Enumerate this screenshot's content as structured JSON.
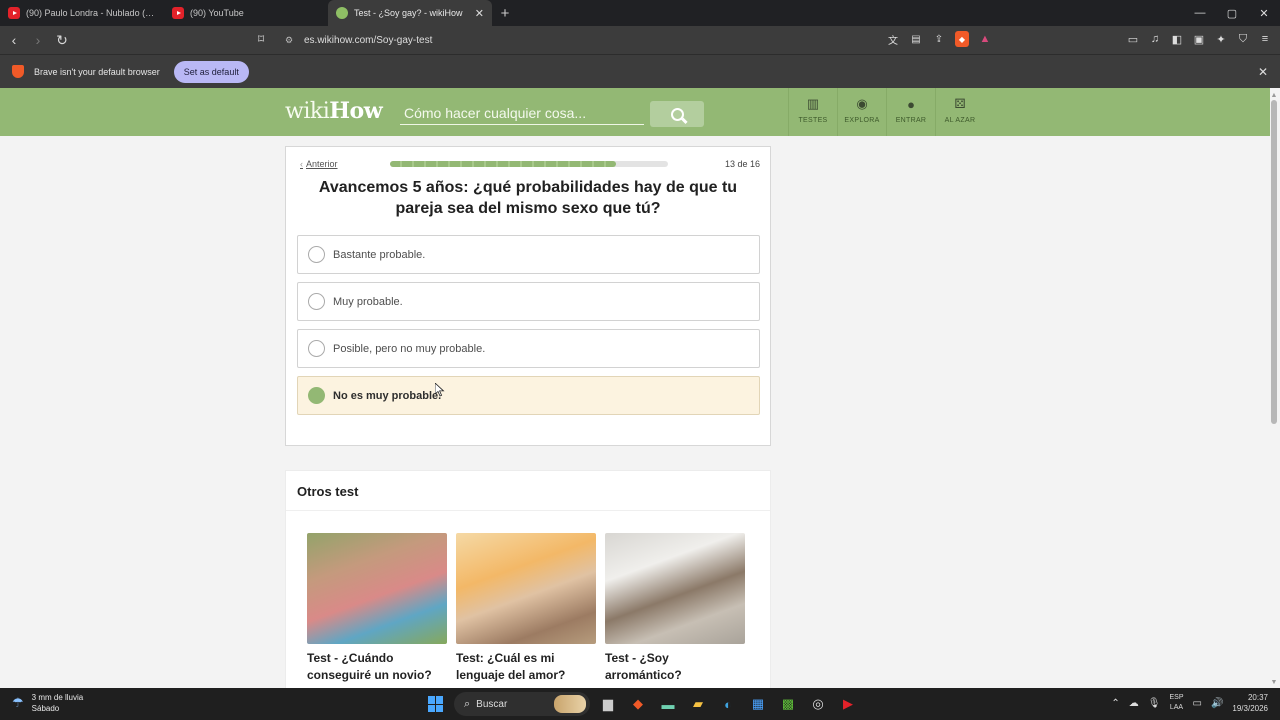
{
  "browser": {
    "tabs": [
      {
        "title": "(90) Paulo Londra - Nublado (Official",
        "favicon": "youtube-icon",
        "active": false
      },
      {
        "title": "(90) YouTube",
        "favicon": "youtube-icon",
        "active": false
      },
      {
        "title": "Test - ¿Soy gay? - wikiHow",
        "favicon": "wikihow-icon",
        "active": true
      }
    ],
    "new_tab": "+",
    "window_controls": {
      "minimize": "—",
      "maximize": "▢",
      "close": "✕"
    },
    "url": "es.wikihow.com/Soy-gay-test",
    "infobar": {
      "message": "Brave isn't your default browser",
      "button": "Set as default",
      "close": "✕"
    }
  },
  "header": {
    "logo_wiki": "wiki",
    "logo_how": "How",
    "search_placeholder": "Cómo hacer cualquier cosa...",
    "nav": [
      {
        "label": "TESTES",
        "icon": "quiz-icon"
      },
      {
        "label": "EXPLORA",
        "icon": "compass-icon"
      },
      {
        "label": "ENTRAR",
        "icon": "user-icon"
      },
      {
        "label": "AL AZAR",
        "icon": "dice-icon"
      }
    ]
  },
  "quiz": {
    "previous": "Anterior",
    "progress": {
      "current": 13,
      "total": 16,
      "label": "13 de 16"
    },
    "question": "Avancemos 5 años: ¿qué probabilidades hay de que tu pareja sea del mismo sexo que tú?",
    "options": [
      {
        "label": "Bastante probable.",
        "selected": false
      },
      {
        "label": "Muy probable.",
        "selected": false
      },
      {
        "label": "Posible, pero no muy probable.",
        "selected": false
      },
      {
        "label": "No es muy probable.",
        "selected": true
      }
    ]
  },
  "others": {
    "heading": "Otros test",
    "cards": [
      {
        "title": "Test - ¿Cuándo conseguiré un novio?"
      },
      {
        "title": "Test: ¿Cuál es mi lenguaje del amor?"
      },
      {
        "title": "Test - ¿Soy arromántico?"
      }
    ]
  },
  "taskbar": {
    "weather_line1": "3 mm de lluvia",
    "weather_line2": "Sábado",
    "search": "Buscar",
    "lang_line1": "ESP",
    "lang_line2": "LAA",
    "time": "20:37",
    "date": "19/3/2026"
  },
  "colors": {
    "wikihow_green": "#93b874",
    "selected_bg": "#fcf3e0"
  }
}
